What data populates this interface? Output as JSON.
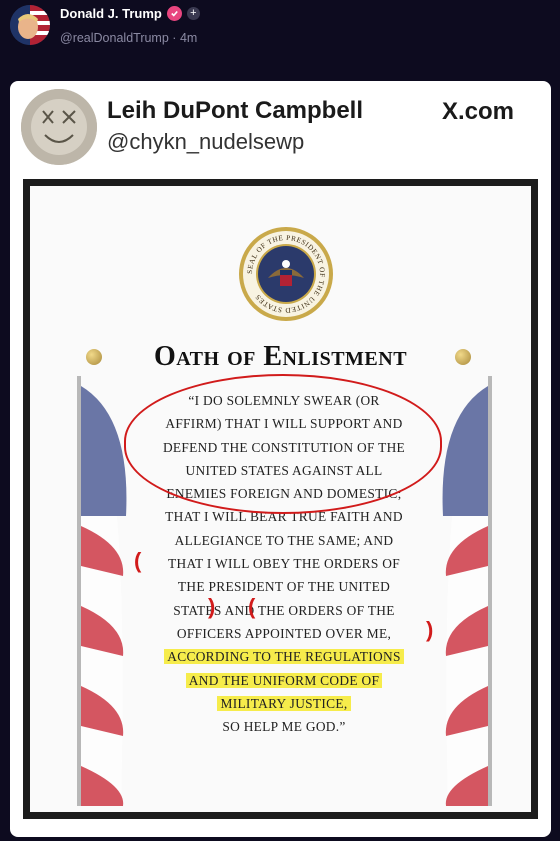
{
  "post": {
    "author_name": "Donald J. Trump",
    "handle": "@realDonaldTrump",
    "separator": "·",
    "time": "4m",
    "plus_label": "+"
  },
  "embed": {
    "display_name": "Leih DuPont Campbell",
    "handle": "@chykn_nudelsewp",
    "source": "X.com"
  },
  "oath": {
    "seal_text": "SEAL OF THE PRESIDENT OF THE UNITED STATES",
    "title": "Oath of Enlistment",
    "lines": [
      "“I DO SOLEMNLY SWEAR (OR",
      "AFFIRM) THAT I WILL SUPPORT AND",
      "DEFEND THE CONSTITUTION OF THE",
      "UNITED STATES AGAINST ALL",
      "ENEMIES FOREIGN AND DOMESTIC;",
      "THAT I WILL BEAR TRUE FAITH AND",
      "ALLEGIANCE TO THE SAME;  AND",
      "THAT I WILL OBEY THE ORDERS OF",
      "THE PRESIDENT OF THE UNITED",
      "STATES AND THE ORDERS OF THE",
      "OFFICERS APPOINTED OVER ME,",
      "ACCORDING TO THE REGULATIONS",
      "AND THE UNIFORM CODE OF",
      "MILITARY JUSTICE,",
      "SO HELP ME GOD.”"
    ]
  },
  "colors": {
    "background": "#0d0b1f",
    "annotation_red": "#d11b1b",
    "highlight_yellow": "#f6ec4b",
    "verified_badge": "#e8457f"
  },
  "icons": [
    "verified-badge-icon",
    "follow-plus-icon",
    "presidential-seal",
    "american-flag"
  ]
}
